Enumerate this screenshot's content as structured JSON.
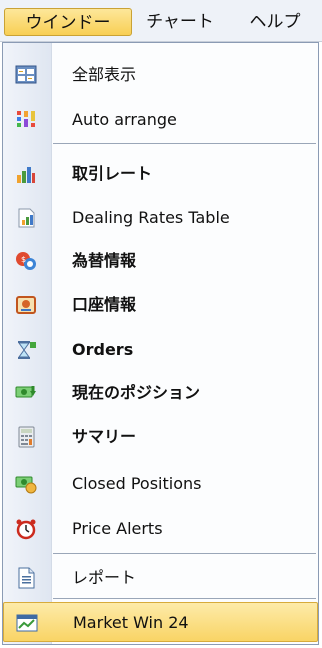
{
  "menubar": {
    "items": [
      {
        "label": "ウインドー",
        "active": true
      },
      {
        "label": "チャート",
        "active": false
      },
      {
        "label": "ヘルプ",
        "active": false
      }
    ]
  },
  "menu": {
    "items": [
      {
        "label": "全部表示",
        "icon": "tile-windows-icon",
        "bold": false
      },
      {
        "label": "Auto arrange",
        "icon": "auto-arrange-icon",
        "bold": false
      },
      {
        "label": "取引レート",
        "icon": "bar-chart-icon",
        "bold": true
      },
      {
        "label": "Dealing Rates Table",
        "icon": "bar-chart-page-icon",
        "bold": false
      },
      {
        "label": "為替情報",
        "icon": "currency-info-icon",
        "bold": true
      },
      {
        "label": "口座情報",
        "icon": "account-info-icon",
        "bold": true
      },
      {
        "label": "Orders",
        "icon": "orders-hourglass-icon",
        "bold": true
      },
      {
        "label": "現在のポジション",
        "icon": "money-down-arrow-icon",
        "bold": true
      },
      {
        "label": "サマリー",
        "icon": "calculator-icon",
        "bold": true
      },
      {
        "label": "Closed Positions",
        "icon": "money-coins-icon",
        "bold": false
      },
      {
        "label": "Price Alerts",
        "icon": "alarm-clock-icon",
        "bold": false
      },
      {
        "label": "レポート",
        "icon": "report-document-icon",
        "bold": false
      },
      {
        "label": "Market Win 24",
        "icon": "market-window-icon",
        "bold": false
      }
    ],
    "highlighted": "Market Win 24"
  },
  "colors": {
    "highlight": "#f9d465",
    "menubar_active": "#f8cf54",
    "gutter": "#dfe6f1"
  }
}
